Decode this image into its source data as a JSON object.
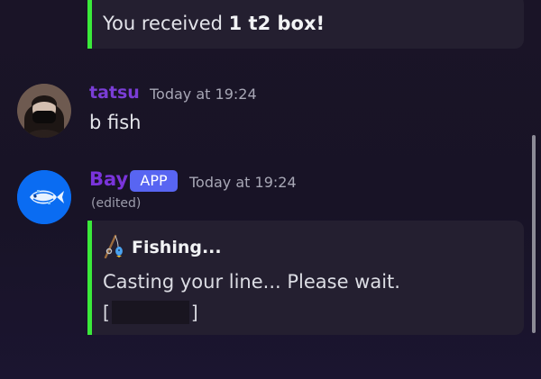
{
  "previous_embed": {
    "text_prefix": "You received ",
    "text_bold": "1 t2 box!",
    "accent_color": "#3ae93a"
  },
  "messages": [
    {
      "username": "tatsu",
      "username_color": "#7a3dd6",
      "timestamp": "Today at 19:24",
      "content": "b fish"
    },
    {
      "username": "Bay",
      "username_color": "#7a34db",
      "badge": "APP",
      "timestamp": "Today at 19:24",
      "edited": "(edited)",
      "embed": {
        "icon": "fishing-rod-icon",
        "title": "Fishing...",
        "description": "Casting your line... Please wait.",
        "progress_left": "[",
        "progress_right": "]",
        "accent_color": "#3ae93a"
      }
    }
  ]
}
